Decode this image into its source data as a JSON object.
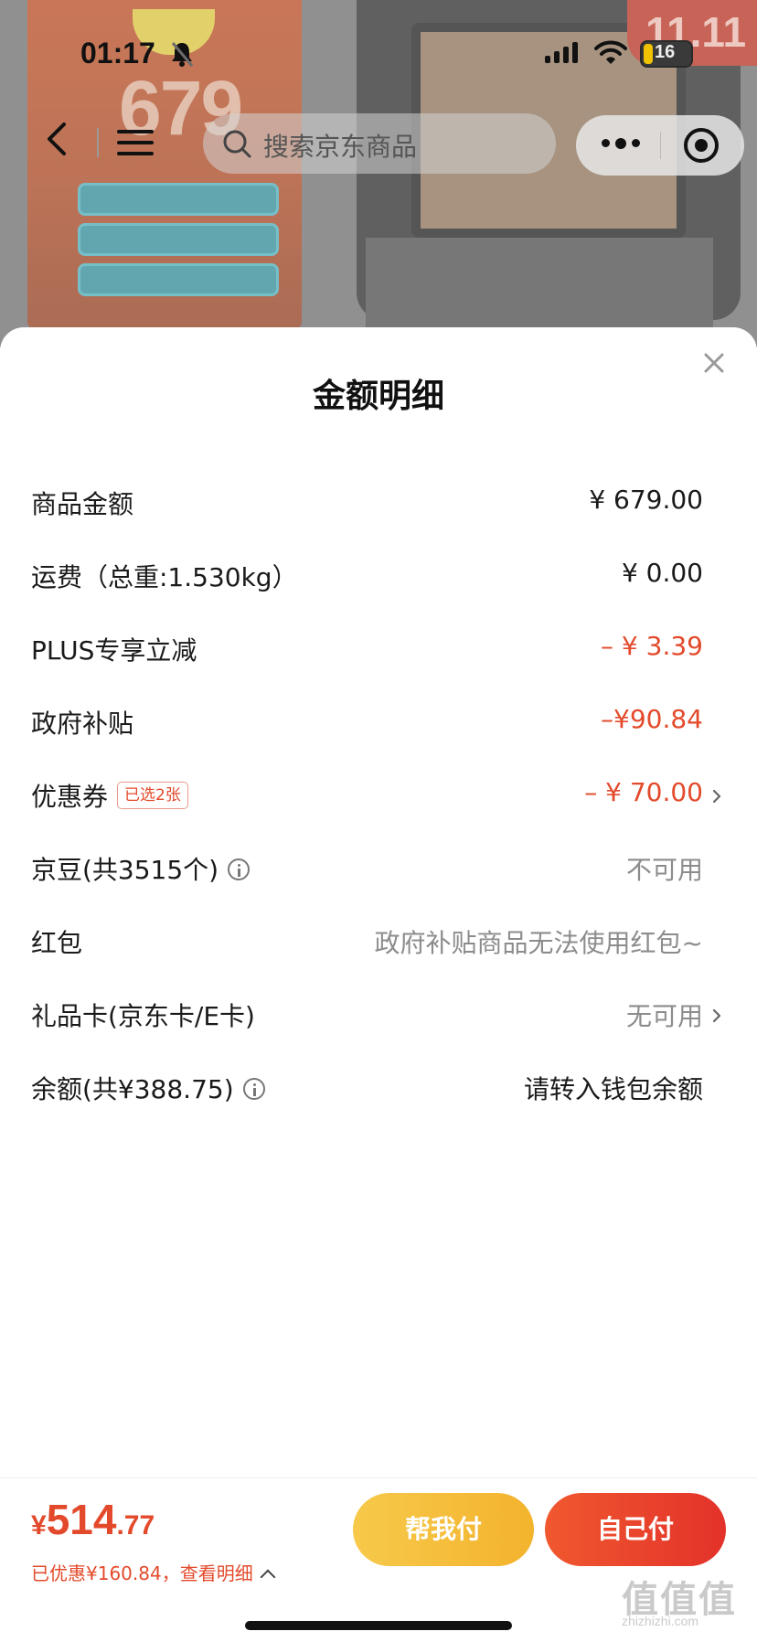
{
  "status_bar": {
    "time": "01:17",
    "battery": "16"
  },
  "nav": {
    "search_placeholder": "搜索京东商品"
  },
  "background": {
    "badge": "11.11",
    "price": "679"
  },
  "sheet": {
    "title": "金额明细",
    "rows": [
      {
        "label": "商品金额",
        "value": "¥ 679.00"
      },
      {
        "label": "运费（总重:1.530kg）",
        "value": "¥ 0.00"
      },
      {
        "label": "PLUS专享立减",
        "value": "– ¥ 3.39"
      },
      {
        "label": "政府补贴",
        "value": "–¥90.84"
      },
      {
        "label": "优惠券",
        "tag": "已选2张",
        "value": "– ¥ 70.00"
      },
      {
        "label": "京豆(共3515个)",
        "value": "不可用"
      },
      {
        "label": "红包",
        "value": "政府补贴商品无法使用红包~"
      },
      {
        "label": "礼品卡(京东卡/E卡)",
        "value": "无可用"
      },
      {
        "label": "余额(共¥388.75)",
        "value": "请转入钱包余额"
      }
    ]
  },
  "footer": {
    "currency": "¥",
    "total_int": "514",
    "total_dec": ".77",
    "saved_text": "已优惠¥160.84，查看明细",
    "help_pay_label": "帮我付",
    "self_pay_label": "自己付"
  },
  "watermark": {
    "big": "值值值",
    "small": "zhizhizhi.com"
  },
  "colors": {
    "accent_red": "#e34a2b",
    "help_pay_yellow": "#f5bf3c",
    "self_pay_red": "#e8412c"
  }
}
